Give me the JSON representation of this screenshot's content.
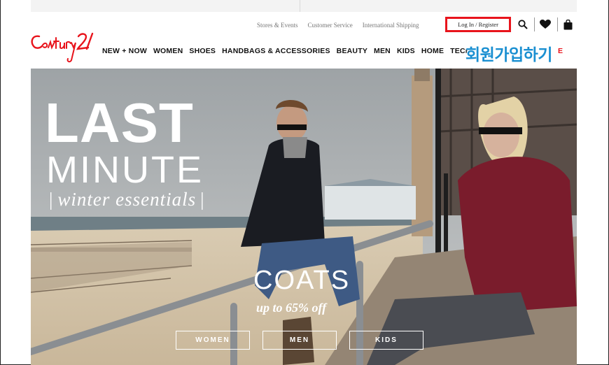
{
  "utility_links": [
    "Stores & Events",
    "Customer Service",
    "International Shipping"
  ],
  "login_label": "Log In / Register",
  "icons": {
    "search": "search-icon",
    "wishlist": "heart-icon",
    "bag": "shopping-bag-icon"
  },
  "logo_text": "Century 21",
  "nav": [
    "NEW + NOW",
    "WOMEN",
    "SHOES",
    "HANDBAGS & ACCESSORIES",
    "BEAUTY",
    "MEN",
    "KIDS",
    "HOME",
    "TECH"
  ],
  "nav_overflow": "E",
  "caption_korean": "회원가입하기",
  "hero": {
    "title_line1": "LAST",
    "title_line2": "MINUTE",
    "subtitle": "winter essentials",
    "promo_title": "COATS",
    "promo_subtitle": "up to 65% off",
    "cta": [
      "WOMEN",
      "MEN",
      "KIDS"
    ]
  },
  "colors": {
    "accent_red": "#e8141c",
    "caption_blue": "#1a8fd1"
  }
}
